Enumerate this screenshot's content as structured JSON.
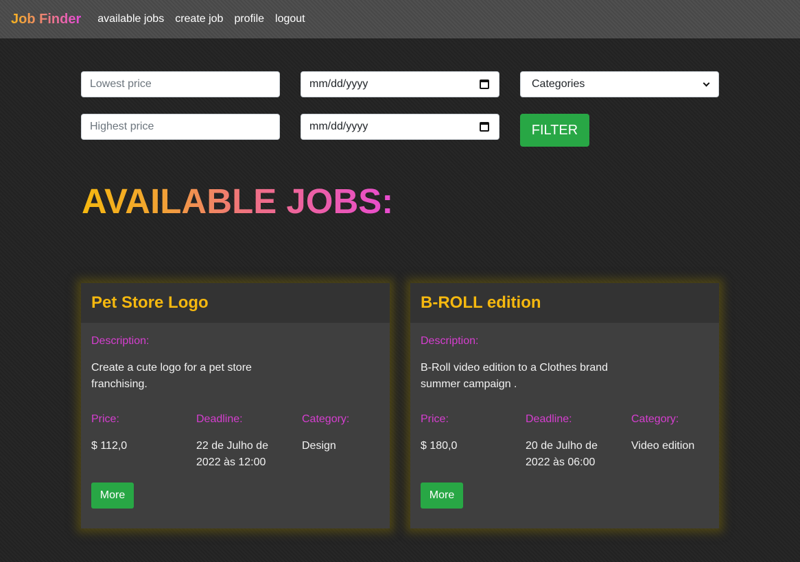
{
  "nav": {
    "brand": "Job Finder",
    "links": [
      "available jobs",
      "create job",
      "profile",
      "logout"
    ]
  },
  "filters": {
    "lowest_price_placeholder": "Lowest price",
    "highest_price_placeholder": "Highest price",
    "date_from_placeholder": "mm/dd/yyyy",
    "date_to_placeholder": "mm/dd/yyyy",
    "categories_selected": "Categories",
    "filter_label": "FILTER"
  },
  "heading": "AVAILABLE JOBS:",
  "jobs": [
    {
      "title": "Pet Store Logo",
      "description_label": "Description:",
      "description": "Create a cute logo for a pet store franchising.",
      "price_label": "Price:",
      "price": "$ 112,0",
      "deadline_label": "Deadline:",
      "deadline": "22 de Julho de 2022 às 12:00",
      "category_label": "Category:",
      "category": "Design",
      "more_label": "More"
    },
    {
      "title": "B-ROLL edition",
      "description_label": "Description:",
      "description": "B-Roll video edition to a Clothes brand summer campaign .",
      "price_label": "Price:",
      "price": "$ 180,0",
      "deadline_label": "Deadline:",
      "deadline": "20 de Julho de 2022 às 06:00",
      "category_label": "Category:",
      "category": "Video edition",
      "more_label": "More"
    }
  ],
  "colors": {
    "accent_yellow": "#f5b80f",
    "accent_magenta": "#d63fd0",
    "button_green": "#28a745"
  }
}
